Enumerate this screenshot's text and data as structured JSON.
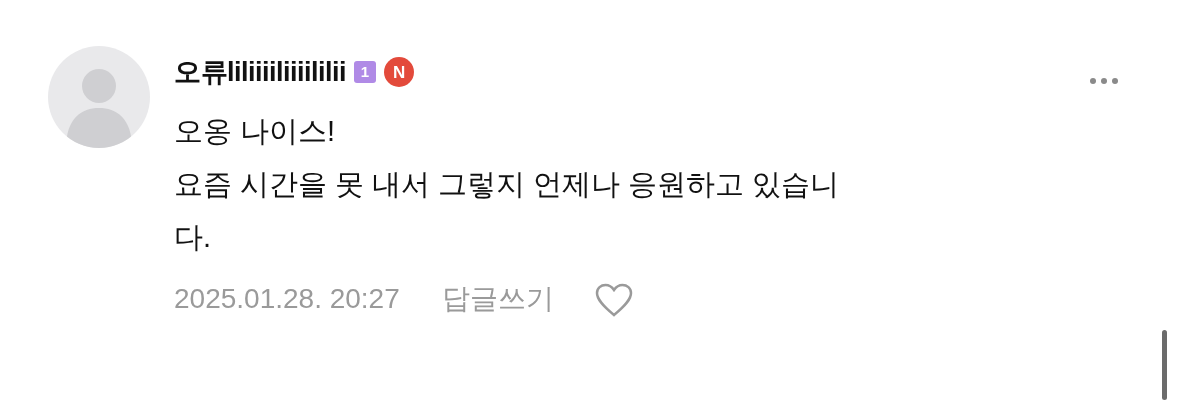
{
  "comment": {
    "author": "오류liliiiiliiiililii",
    "level_badge": "1",
    "new_badge": "N",
    "paragraphs": [
      "오옹 나이스!",
      "요즘 시간을 못 내서 그렇지 언제나 응원하고 있습니다."
    ],
    "date": "2025.01.28. 20:27",
    "reply_link": "답글쓰기",
    "liked": false
  }
}
